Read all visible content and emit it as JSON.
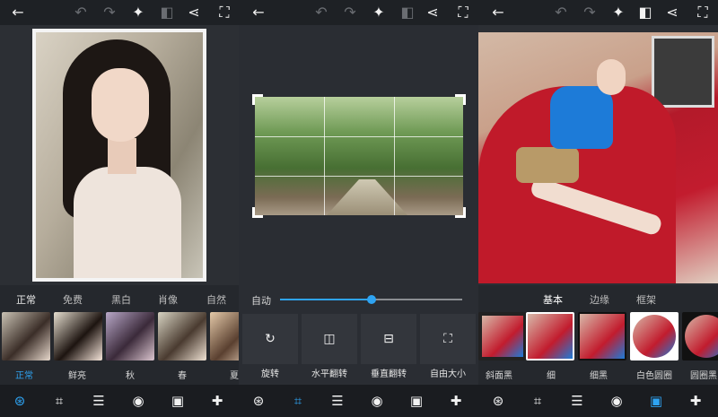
{
  "colors": {
    "accent": "#2ea3f2",
    "background": "#25282d",
    "bar": "#1a1c20"
  },
  "icons_top": [
    "back-arrow-icon",
    "undo-icon",
    "redo-icon",
    "magic-wand-icon",
    "compare-icon",
    "share-icon",
    "fullscreen-icon"
  ],
  "icons_bottom": [
    "filters-icon",
    "crop-icon",
    "adjust-icon",
    "eye-icon",
    "frame-icon",
    "healing-icon"
  ],
  "panel1": {
    "filter_tabs": [
      "正常",
      "免费",
      "黑白",
      "肖像",
      "自然"
    ],
    "filter_names": [
      "正常",
      "鲜亮",
      "秋",
      "春",
      "夏"
    ],
    "selected_filter": "正常"
  },
  "panel2": {
    "slider_label": "自动",
    "slider_value": 0.5,
    "tools": [
      "旋转",
      "水平翻转",
      "垂直翻转",
      "自由大小"
    ]
  },
  "panel3": {
    "tabs": [
      "基本",
      "边缘",
      "框架"
    ],
    "selected_tab": "基本",
    "frame_names": [
      "斜面黑",
      "细",
      "细黑",
      "白色圆圈",
      "圆圈黑"
    ]
  }
}
